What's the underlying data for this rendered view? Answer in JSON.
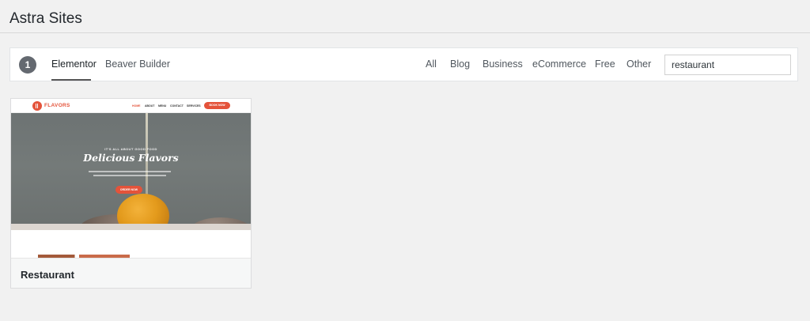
{
  "page": {
    "title": "Astra Sites"
  },
  "filters": {
    "step_number": "1",
    "page_builders": [
      {
        "label": "Elementor",
        "active": true
      },
      {
        "label": "Beaver Builder",
        "active": false
      }
    ],
    "categories": [
      "All",
      "Blog",
      "Business",
      "eCommerce",
      "Free",
      "Other"
    ],
    "search": {
      "value": "restaurant",
      "placeholder": ""
    }
  },
  "sites": [
    {
      "title": "Restaurant",
      "preview": {
        "brand": "FLAVORS",
        "nav": [
          "HOME",
          "ABOUT",
          "MENU",
          "CONTACT",
          "SERVICES"
        ],
        "nav_cta": "BOOK NOW",
        "kicker": "IT'S ALL ABOUT GOOD FOOD",
        "headline": "Delicious Flavors",
        "cta": "ORDER NOW"
      }
    }
  ],
  "colors": {
    "accent": "#e4533a",
    "badge": "#646970"
  }
}
